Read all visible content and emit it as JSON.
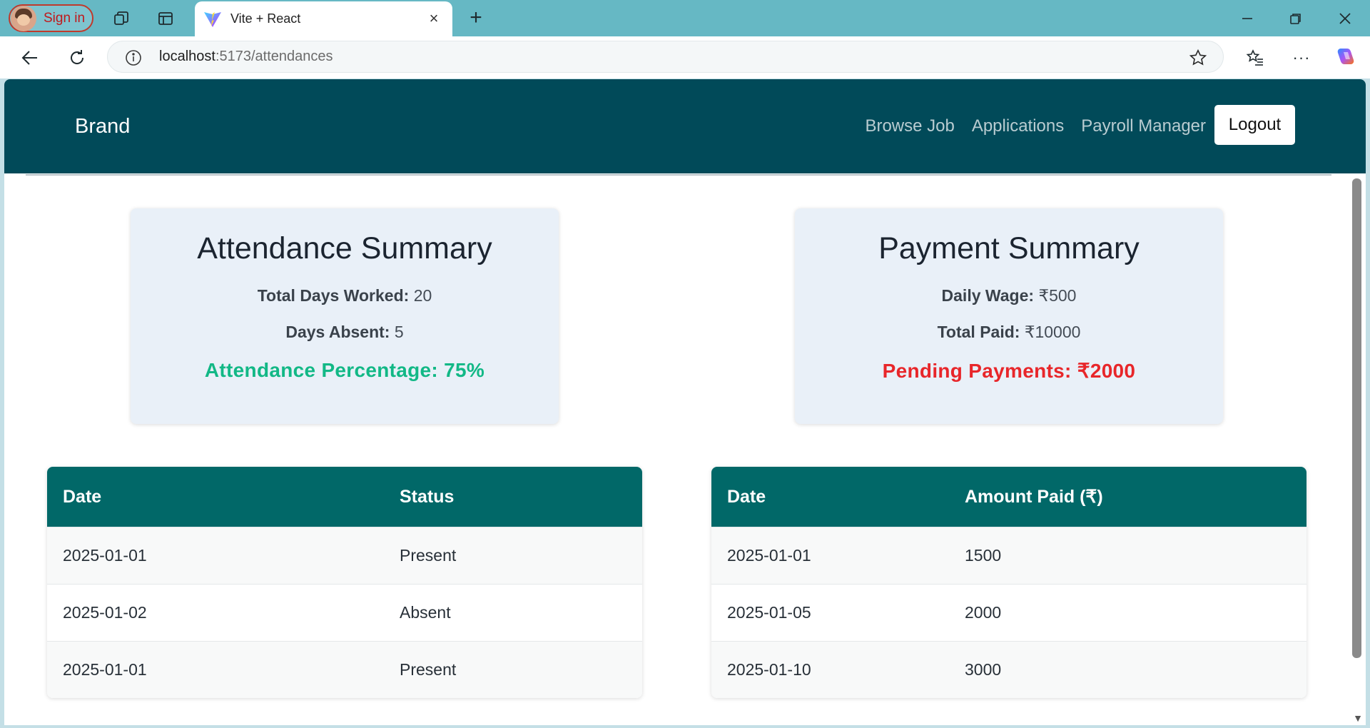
{
  "browser": {
    "profile_label": "Sign in",
    "tab_title": "Vite + React",
    "url_host": "localhost",
    "url_path": ":5173/attendances"
  },
  "navbar": {
    "brand": "Brand",
    "links": [
      "Browse Job",
      "Applications",
      "Payroll Manager"
    ],
    "logout_label": "Logout"
  },
  "attendance_summary": {
    "title": "Attendance Summary",
    "total_days_label": "Total Days Worked:",
    "total_days_value": "20",
    "days_absent_label": "Days Absent:",
    "days_absent_value": "5",
    "percentage_label": "Attendance Percentage:",
    "percentage_value": "75%",
    "percentage_color": "#12b886"
  },
  "payment_summary": {
    "title": "Payment Summary",
    "daily_wage_label": "Daily Wage:",
    "daily_wage_value": "₹500",
    "total_paid_label": "Total Paid:",
    "total_paid_value": "₹10000",
    "pending_label": "Pending Payments:",
    "pending_value": "₹2000",
    "pending_color": "#e8262a"
  },
  "attendance_table": {
    "headers": [
      "Date",
      "Status"
    ],
    "rows": [
      [
        "2025-01-01",
        "Present"
      ],
      [
        "2025-01-02",
        "Absent"
      ],
      [
        "2025-01-01",
        "Present"
      ]
    ]
  },
  "payment_table": {
    "headers": [
      "Date",
      "Amount Paid (₹)"
    ],
    "rows": [
      [
        "2025-01-01",
        "1500"
      ],
      [
        "2025-01-05",
        "2000"
      ],
      [
        "2025-01-10",
        "3000"
      ]
    ]
  }
}
